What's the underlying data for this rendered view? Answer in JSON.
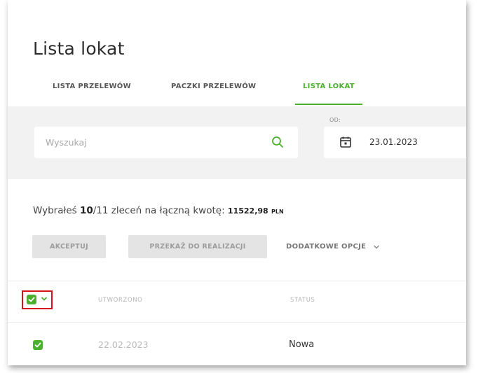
{
  "page": {
    "title": "Lista lokat"
  },
  "tabs": [
    {
      "label": "LISTA PRZELEWÓW",
      "active": false
    },
    {
      "label": "PACZKI PRZELEWÓW",
      "active": false
    },
    {
      "label": "LISTA LOKAT",
      "active": true
    }
  ],
  "filters": {
    "search_placeholder": "Wyszukaj",
    "date_from_label": "OD:",
    "date_from_value": "23.01.2023"
  },
  "summary": {
    "prefix": "Wybrałeś ",
    "selected": "10",
    "total_part": "/11 zleceń na łączną kwotę: ",
    "amount": "11522,98",
    "currency": "PLN"
  },
  "actions": {
    "accept_label": "AKCEPTUJ",
    "send_label": "PRZEKAŻ DO REALIZACJI",
    "more_label": "DODATKOWE OPCJE"
  },
  "table": {
    "columns": [
      "UTWORZONO",
      "STATUS"
    ],
    "rows": [
      {
        "created": "22.02.2023",
        "status": "Nowa",
        "checked": true
      }
    ]
  },
  "colors": {
    "accent": "#4caf2f",
    "highlight": "#d8121b"
  }
}
